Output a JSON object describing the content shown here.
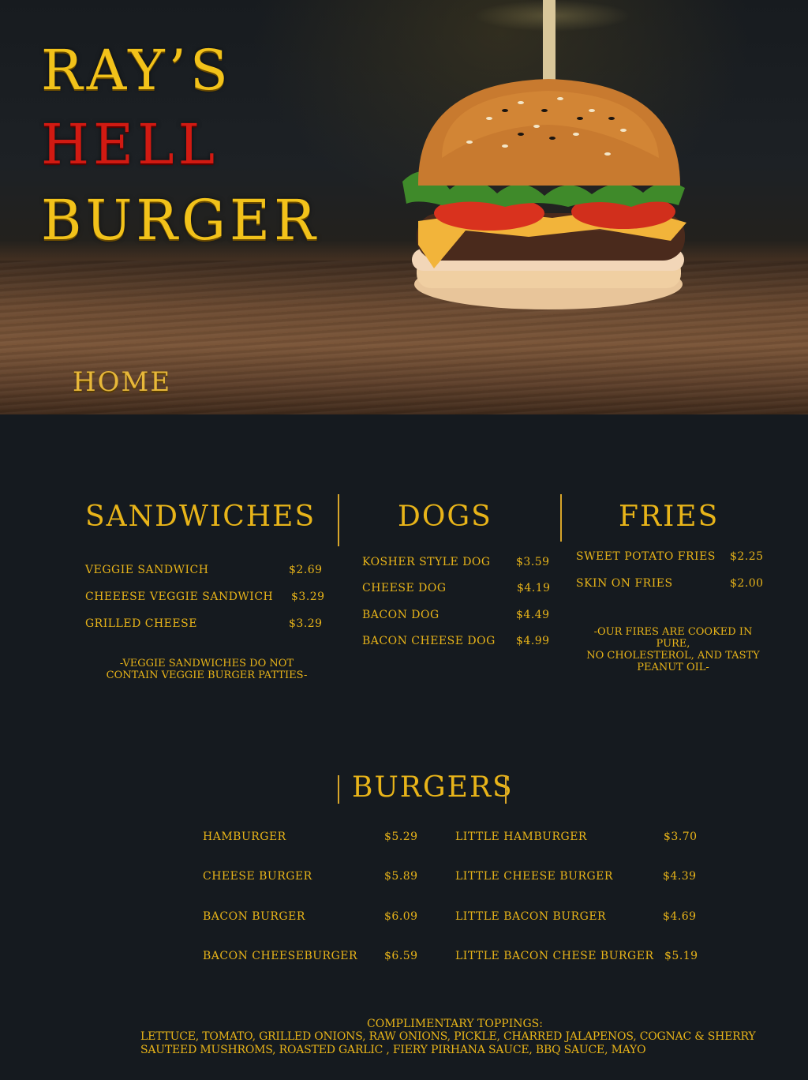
{
  "header": {
    "title_lines": [
      "RAY’S",
      "HELL",
      "BURGER"
    ],
    "nav_home": "HOME"
  },
  "colors": {
    "gold": "#e8b419",
    "red": "#d11a12",
    "background": "#151a1f"
  },
  "sandwiches": {
    "title": "SANDWICHES",
    "items": [
      {
        "name": "VEGGIE SANDWICH",
        "price": "$2.69"
      },
      {
        "name": "CHEEESE VEGGIE SANDWICH",
        "price": "$3.29"
      },
      {
        "name": "GRILLED CHEESE",
        "price": "$3.29"
      }
    ],
    "note_lines": [
      "-VEGGIE SANDWICHES DO NOT",
      "CONTAIN VEGGIE BURGER PATTIES-"
    ]
  },
  "dogs": {
    "title": "DOGS",
    "items": [
      {
        "name": "KOSHER STYLE DOG",
        "price": "$3.59"
      },
      {
        "name": "CHEESE DOG",
        "price": "$4.19"
      },
      {
        "name": "BACON DOG",
        "price": "$4.49"
      },
      {
        "name": "BACON CHEESE DOG",
        "price": "$4.99"
      }
    ]
  },
  "fries": {
    "title": "FRIES",
    "items": [
      {
        "name": "SWEET POTATO FRIES",
        "price": "$2.25"
      },
      {
        "name": "SKIN ON FRIES",
        "price": "$2.00"
      }
    ],
    "note_lines": [
      "-OUR FIRES ARE COOKED IN PURE,",
      "NO CHOLESTEROL, AND TASTY",
      "PEANUT OIL-"
    ]
  },
  "burgers": {
    "title": "BURGERS",
    "left": [
      {
        "name": "HAMBURGER",
        "price": "$5.29"
      },
      {
        "name": "CHEESE BURGER",
        "price": "$5.89"
      },
      {
        "name": "BACON BURGER",
        "price": "$6.09"
      },
      {
        "name": "BACON CHEESEBURGER",
        "price": "$6.59"
      }
    ],
    "right": [
      {
        "name": "LITTLE HAMBURGER",
        "price": "$3.70"
      },
      {
        "name": "LITTLE CHEESE BURGER",
        "price": "$4.39"
      },
      {
        "name": "LITTLE BACON BURGER",
        "price": "$4.69"
      },
      {
        "name": "LITTLE BACON CHESE BURGER",
        "price": "$5.19"
      }
    ]
  },
  "toppings": {
    "title": "COMPLIMENTARY TOPPINGS:",
    "lines": [
      "LETTUCE, TOMATO, GRILLED ONIONS, RAW ONIONS, PICKLE, CHARRED JALAPENOS, COGNAC & SHERRY",
      "SAUTEED MUSHROMS, ROASTED GARLIC , FIERY PIRHANA SAUCE, BBQ SAUCE, MAYO"
    ]
  }
}
